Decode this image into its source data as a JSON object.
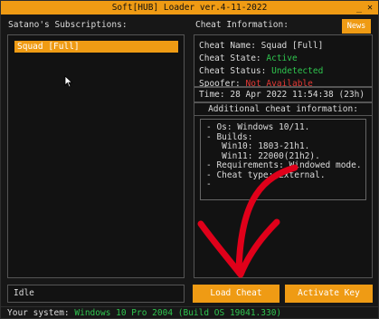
{
  "window": {
    "title": "Soft[HUB] Loader ver.4-11-2022",
    "controls": [
      "_",
      "✕"
    ]
  },
  "left": {
    "label": "Satano's Subscriptions:",
    "items": [
      {
        "label": "Squad [Full]",
        "selected": true
      }
    ],
    "status": "Idle"
  },
  "right": {
    "label": "Cheat Information:",
    "news_button": "News",
    "info": {
      "name_label": "Cheat Name:",
      "name_value": "Squad [Full]",
      "state_label": "Cheat State:",
      "state_value": "Active",
      "status_label": "Cheat Status:",
      "status_value": "Undetected",
      "spoofer_label": "Spoofer:",
      "spoofer_value": "Not Available"
    },
    "time_label": "Time:",
    "time_value": "28 Apr 2022 11:54:38 (23h)",
    "additional_title": "Additional cheat information:",
    "additional_lines": [
      "- Os: Windows 10/11.",
      "- Builds:",
      "   Win10: 1803-21h1.",
      "   Win11: 22000(21h2).",
      "- Requirements: Windowed mode.",
      "- Cheat type: External.",
      "-"
    ],
    "load_button": "Load Cheat",
    "activate_button": "Activate Key"
  },
  "footer": {
    "label": "Your system:",
    "value": "Windows 10 Pro 2004 (Build OS 19041.330)"
  },
  "colors": {
    "accent": "#ef9b14",
    "ok": "#2fc64f",
    "bad": "#e53935",
    "annotation_arrow": "#e0001a"
  }
}
